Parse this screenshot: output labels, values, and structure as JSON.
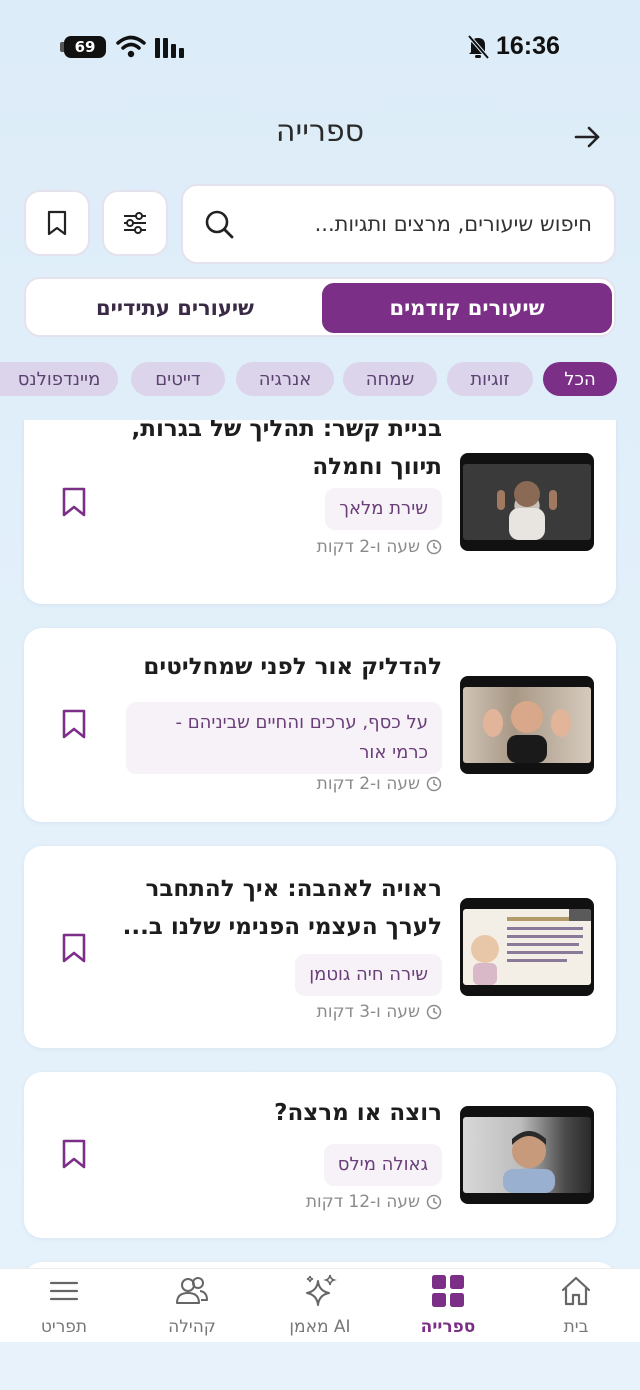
{
  "status_bar": {
    "time": "16:36",
    "battery": "69"
  },
  "header": {
    "title": "ספרייה"
  },
  "search": {
    "placeholder": "חיפוש שיעורים, מרצים ותגיות..."
  },
  "segmented": {
    "active_label": "שיעורים קודמים",
    "inactive_label": "שיעורים עתידיים"
  },
  "chips": [
    "הכל",
    "זוגיות",
    "שמחה",
    "אנרגיה",
    "דייטים",
    "מיינדפולנס"
  ],
  "lessons": [
    {
      "title": "בניית קשר: תהליך של בגרות, תיווך וחמלה",
      "speaker": "שירת מלאך",
      "duration": "שעה ו-2 דקות"
    },
    {
      "title": "להדליק אור לפני שמחליטים",
      "speaker": "על כסף, ערכים והחיים שביניהם - כרמי אור",
      "duration": "שעה ו-2 דקות"
    },
    {
      "title": "ראויה לאהבה: איך להתחבר לערך העצמי הפנימי שלנו ב...",
      "speaker": "שירה חיה גוטמן",
      "duration": "שעה ו-3 דקות"
    },
    {
      "title": "רוצה או מרצה?",
      "speaker": "גאולה מילס",
      "duration": "שעה ו-12 דקות"
    }
  ],
  "tabbar": {
    "home": "בית",
    "library": "ספרייה",
    "ai": "מאמן AI",
    "community": "קהילה",
    "menu": "תפריט"
  },
  "colors": {
    "accent": "#7b2f86",
    "background": "#e0eefa"
  }
}
